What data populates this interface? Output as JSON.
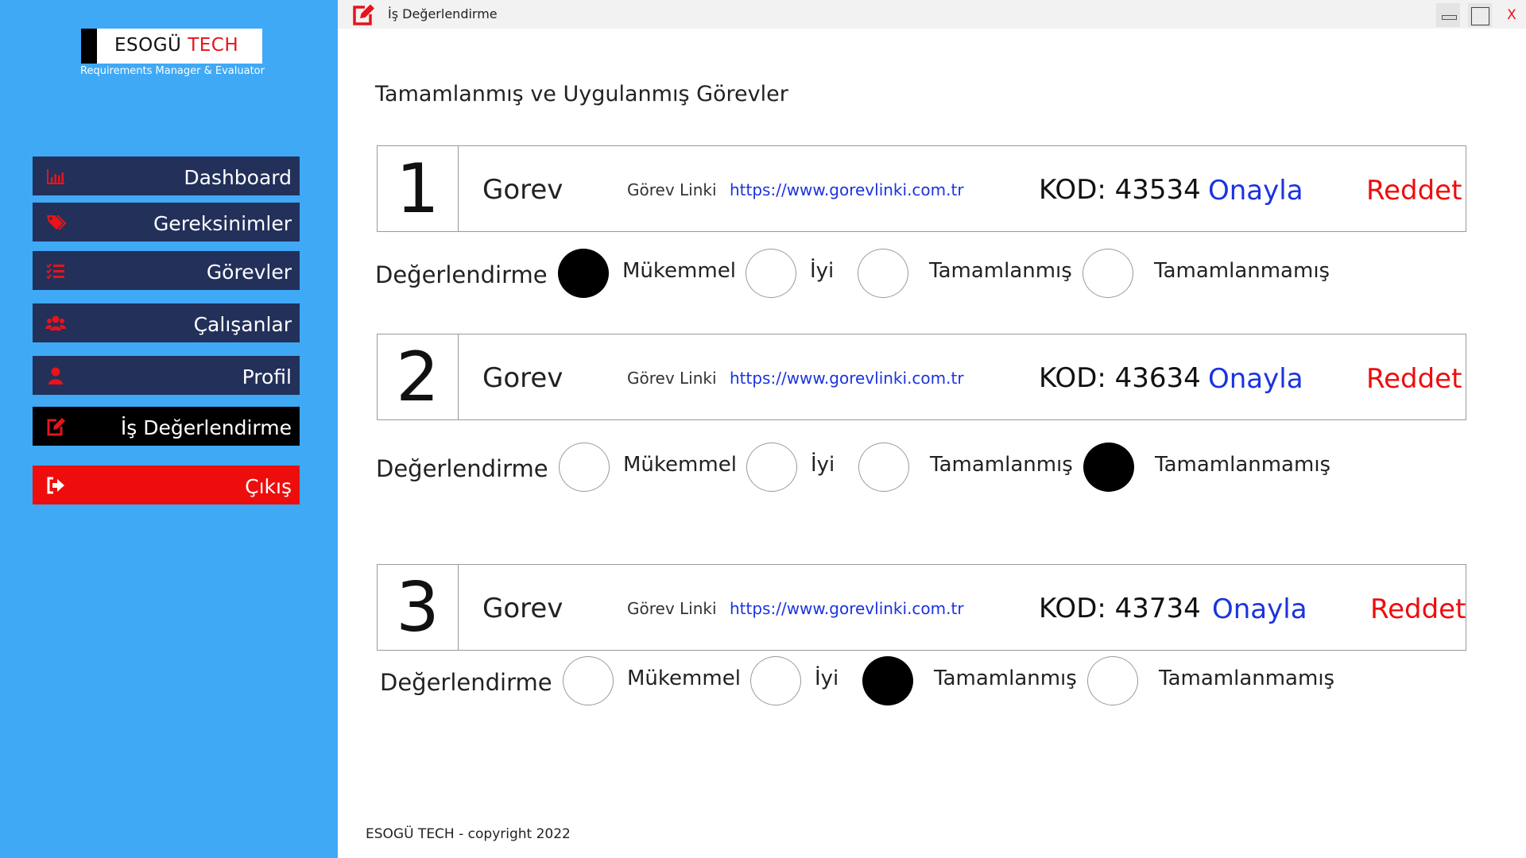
{
  "app": {
    "logo_brand": "ESOGÜ",
    "logo_brand_accent": "TECH",
    "logo_subtitle": "Requirements Manager & Evaluator",
    "window_title": "İş Değerlendirme",
    "close_label": "X"
  },
  "sidebar": {
    "items": [
      {
        "label": "Dashboard",
        "icon": "bar-chart-icon"
      },
      {
        "label": "Gereksinimler",
        "icon": "tag-icon"
      },
      {
        "label": "Görevler",
        "icon": "tasks-icon"
      },
      {
        "label": "Çalışanlar",
        "icon": "users-icon"
      },
      {
        "label": "Profil",
        "icon": "user-icon"
      },
      {
        "label": "İş Değerlendirme",
        "icon": "edit-icon"
      },
      {
        "label": "Çıkış",
        "icon": "sign-out-icon"
      }
    ],
    "active_index": 5
  },
  "main": {
    "heading": "Tamamlanmış ve Uygulanmış Görevler",
    "rating_label": "Değerlendirme",
    "rating_options": [
      "Mükemmel",
      "İyi",
      "Tamamlanmış",
      "Tamamlanmamış"
    ],
    "tasks": [
      {
        "number": "1",
        "name": "Gorev",
        "link_label": "Görev Linki",
        "link": "https://www.gorevlinki.com.tr",
        "code": "KOD: 43534",
        "approve": "Onayla",
        "reject": "Reddet",
        "selected_rating": 0
      },
      {
        "number": "2",
        "name": "Gorev",
        "link_label": "Görev Linki",
        "link": "https://www.gorevlinki.com.tr",
        "code": "KOD: 43634",
        "approve": "Onayla",
        "reject": "Reddet",
        "selected_rating": 3
      },
      {
        "number": "3",
        "name": "Gorev",
        "link_label": "Görev Linki",
        "link": "https://www.gorevlinki.com.tr",
        "code": "KOD: 43734",
        "approve": "Onayla",
        "reject": "Reddet",
        "selected_rating": 2
      }
    ]
  },
  "footer": {
    "text": "ESOGÜ TECH - copyright 2022"
  },
  "colors": {
    "sidebar_bg": "#3fa9f5",
    "nav_bg": "#22305a",
    "nav_active_bg": "#000000",
    "logout_bg": "#ee0d0d",
    "icon_red": "#e8131b",
    "link_blue": "#1a33e0",
    "reject_red": "#ee0d0d"
  }
}
